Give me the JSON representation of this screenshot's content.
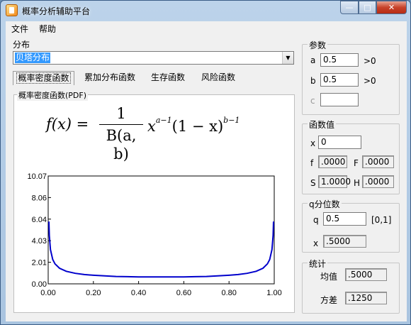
{
  "window": {
    "title": "概率分析辅助平台",
    "min": "—",
    "max": "□",
    "close": "✕"
  },
  "menu": [
    "文件",
    "帮助"
  ],
  "distribution": {
    "label": "分布",
    "selected": "贝塔分布"
  },
  "tabs": [
    "概率密度函数",
    "累加分布函数",
    "生存函数",
    "风险函数"
  ],
  "pdf_panel": {
    "title": "概率密度函数(PDF)",
    "formula": {
      "lhs": "f(x) =",
      "numerator": "1",
      "denominator": "B(a, b)",
      "term1_base": "x",
      "term1_exp": "a−1",
      "term2_base": "(1 − x)",
      "term2_exp": "b−1"
    }
  },
  "params": {
    "title": "参数",
    "a_label": "a",
    "a_value": "0.5",
    "a_constraint": ">0",
    "b_label": "b",
    "b_value": "0.5",
    "b_constraint": ">0",
    "c_label": "c",
    "c_value": ""
  },
  "function_values": {
    "title": "函数值",
    "x_label": "x",
    "x_value": "0",
    "f_label": "f",
    "f_value": ".0000",
    "F_label": "F",
    "F_value": ".0000",
    "S_label": "S",
    "S_value": "1.0000",
    "H_label": "H",
    "H_value": ".0000"
  },
  "quantile": {
    "title": "q分位数",
    "q_label": "q",
    "q_value": "0.5",
    "q_range": "[0,1]",
    "x_label": "x",
    "x_value": ".5000"
  },
  "stats": {
    "title": "统计",
    "mean_label": "均值",
    "mean_value": ".5000",
    "var_label": "方差",
    "var_value": ".1250"
  },
  "chart_data": {
    "type": "line",
    "title": "",
    "xlabel": "",
    "ylabel": "",
    "xlim": [
      0,
      1
    ],
    "ylim": [
      0,
      10.07
    ],
    "xticks": [
      "0.00",
      "0.20",
      "0.40",
      "0.60",
      "0.80",
      "1.00"
    ],
    "yticks": [
      "0.00",
      "2.01",
      "4.03",
      "6.04",
      "8.06",
      "10.07"
    ],
    "grid": false,
    "series": [
      {
        "color": "#0000cc",
        "x": [
          0.003,
          0.005,
          0.01,
          0.02,
          0.03,
          0.05,
          0.08,
          0.12,
          0.16,
          0.2,
          0.25,
          0.3,
          0.35,
          0.4,
          0.45,
          0.5,
          0.55,
          0.6,
          0.65,
          0.7,
          0.75,
          0.8,
          0.84,
          0.88,
          0.92,
          0.95,
          0.97,
          0.98,
          0.99,
          0.995,
          0.997
        ],
        "y": [
          5.82,
          4.51,
          3.2,
          2.27,
          1.87,
          1.46,
          1.17,
          0.98,
          0.87,
          0.8,
          0.74,
          0.69,
          0.67,
          0.65,
          0.64,
          0.64,
          0.64,
          0.65,
          0.67,
          0.69,
          0.74,
          0.8,
          0.87,
          0.98,
          1.17,
          1.46,
          1.87,
          2.27,
          3.2,
          4.51,
          5.82
        ]
      }
    ]
  }
}
